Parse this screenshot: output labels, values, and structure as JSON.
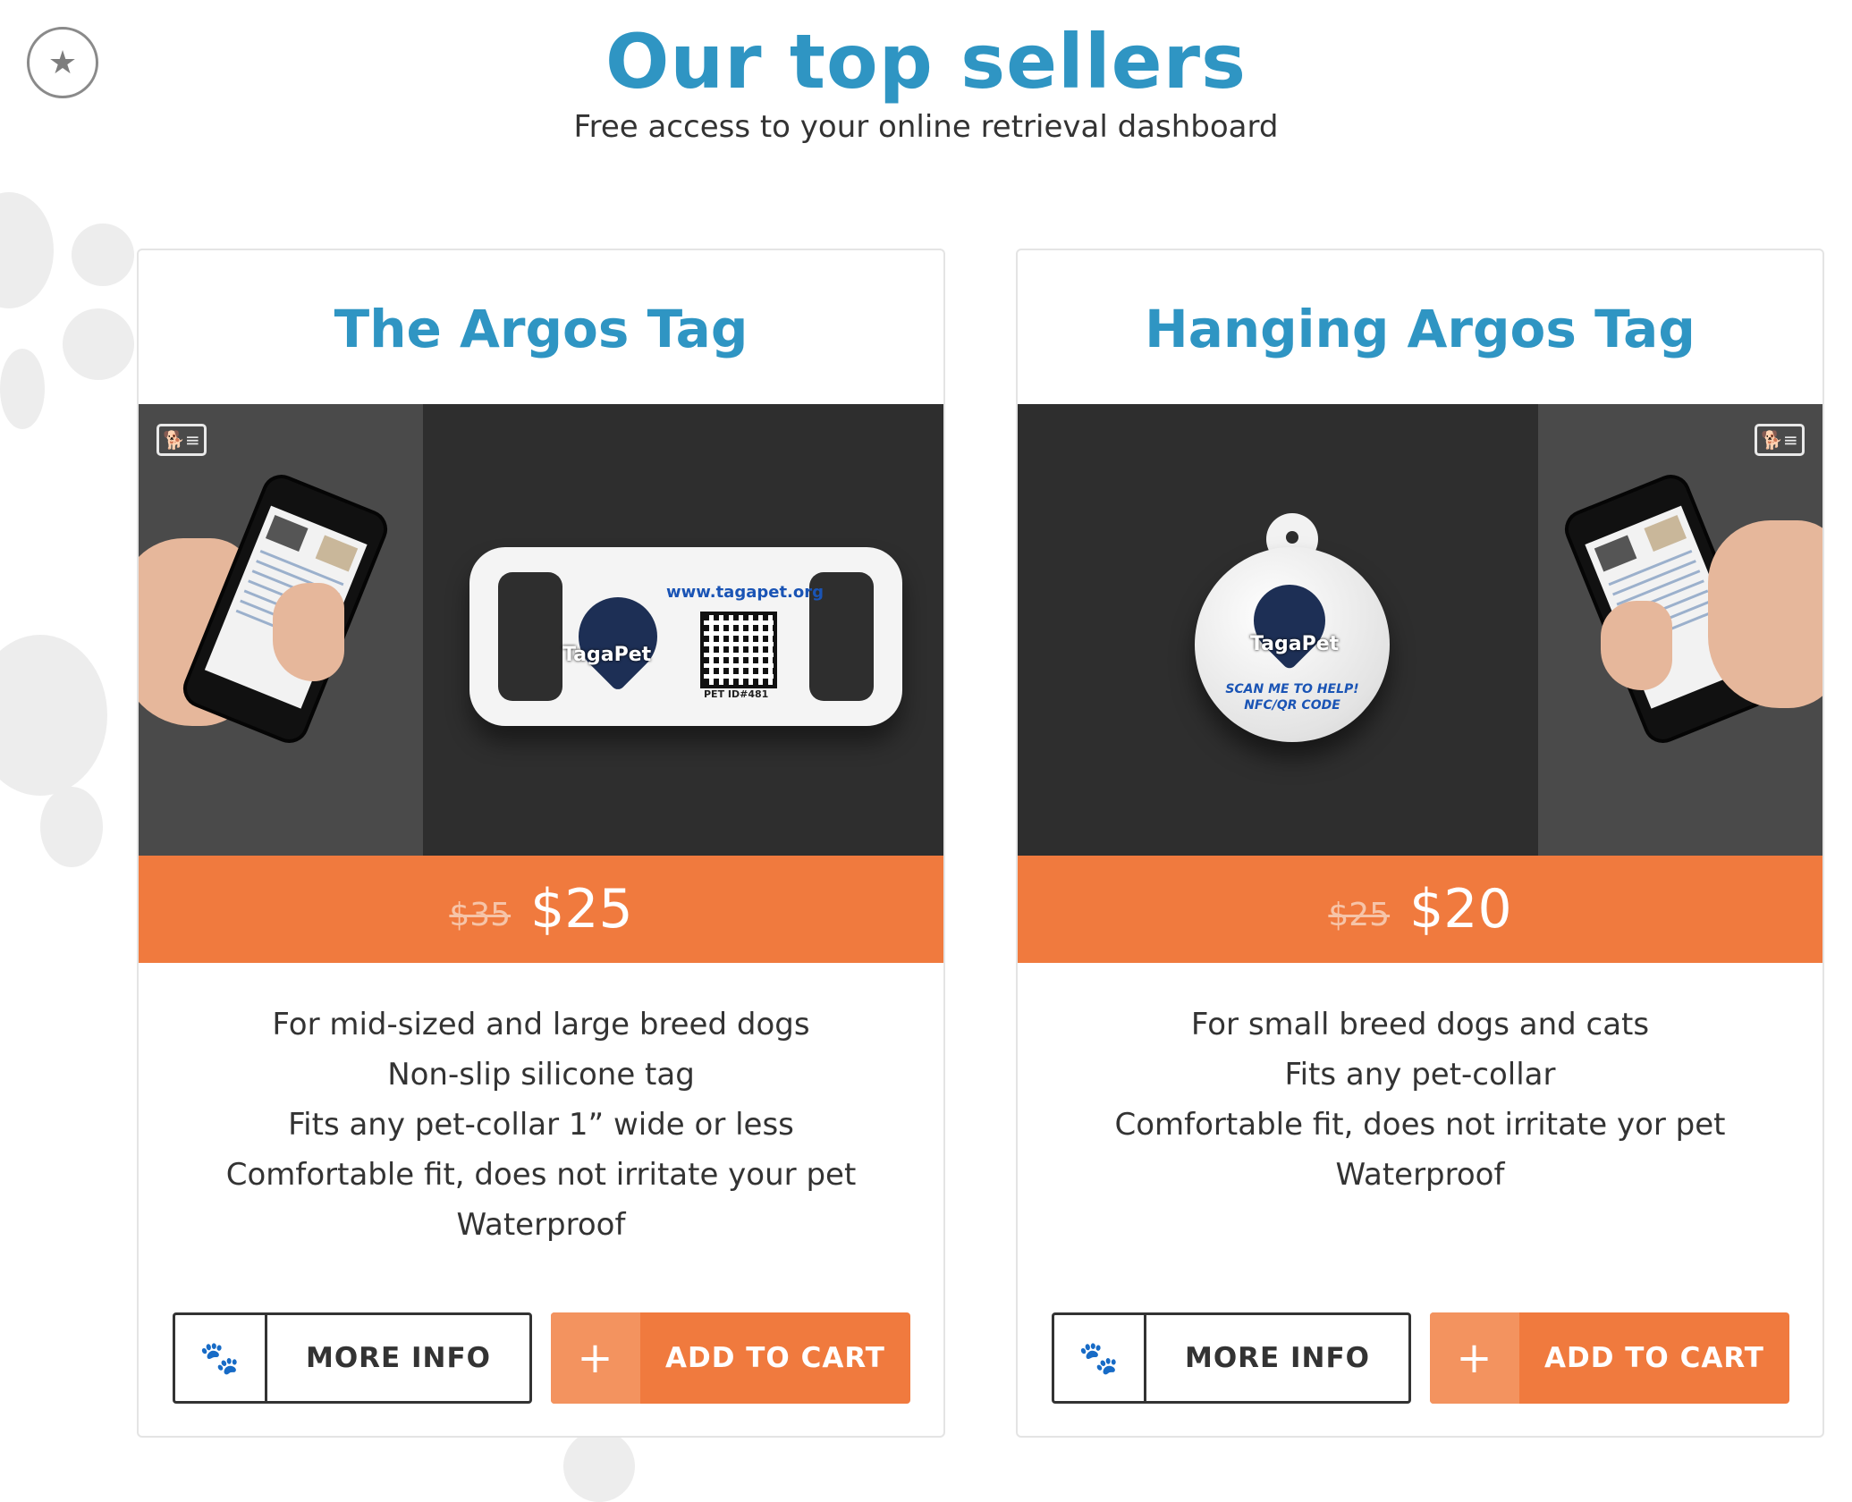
{
  "header": {
    "title": "Our top sellers",
    "subtitle": "Free access to your online retrieval dashboard",
    "favorite_icon": "star-icon"
  },
  "colors": {
    "title_blue": "#2f95c3",
    "price_orange": "#f07a3e",
    "cart_icon_orange": "#f3935f"
  },
  "products": [
    {
      "title": "The Argos Tag",
      "image": {
        "tag_url": "www.tagapet.org",
        "logo_text": "TagaPet",
        "pet_id": "PET ID#481"
      },
      "old_price": "$35",
      "price": "$25",
      "features": [
        "For mid-sized and large breed dogs",
        "Non-slip silicone tag",
        "Fits any pet-collar 1” wide or less",
        "Comfortable fit, does not irritate your pet",
        "Waterproof"
      ],
      "more_info_label": "MORE INFO",
      "add_to_cart_label": "ADD TO CART",
      "more_info_icon": "paw-icon",
      "add_to_cart_icon": "plus-icon",
      "add_to_cart_symbol": "+"
    },
    {
      "title": "Hanging Argos Tag",
      "image": {
        "logo_text": "TagaPet",
        "scan_line1": "SCAN ME TO HELP!",
        "scan_line2": "NFC/QR CODE"
      },
      "old_price": "$25",
      "price": "$20",
      "features": [
        "For small breed dogs and cats",
        "Fits any pet-collar",
        "Comfortable fit, does not irritate yor pet",
        "Waterproof"
      ],
      "more_info_label": "MORE INFO",
      "add_to_cart_label": "ADD TO CART",
      "more_info_icon": "paw-icon",
      "add_to_cart_icon": "plus-icon",
      "add_to_cart_symbol": "+"
    }
  ]
}
